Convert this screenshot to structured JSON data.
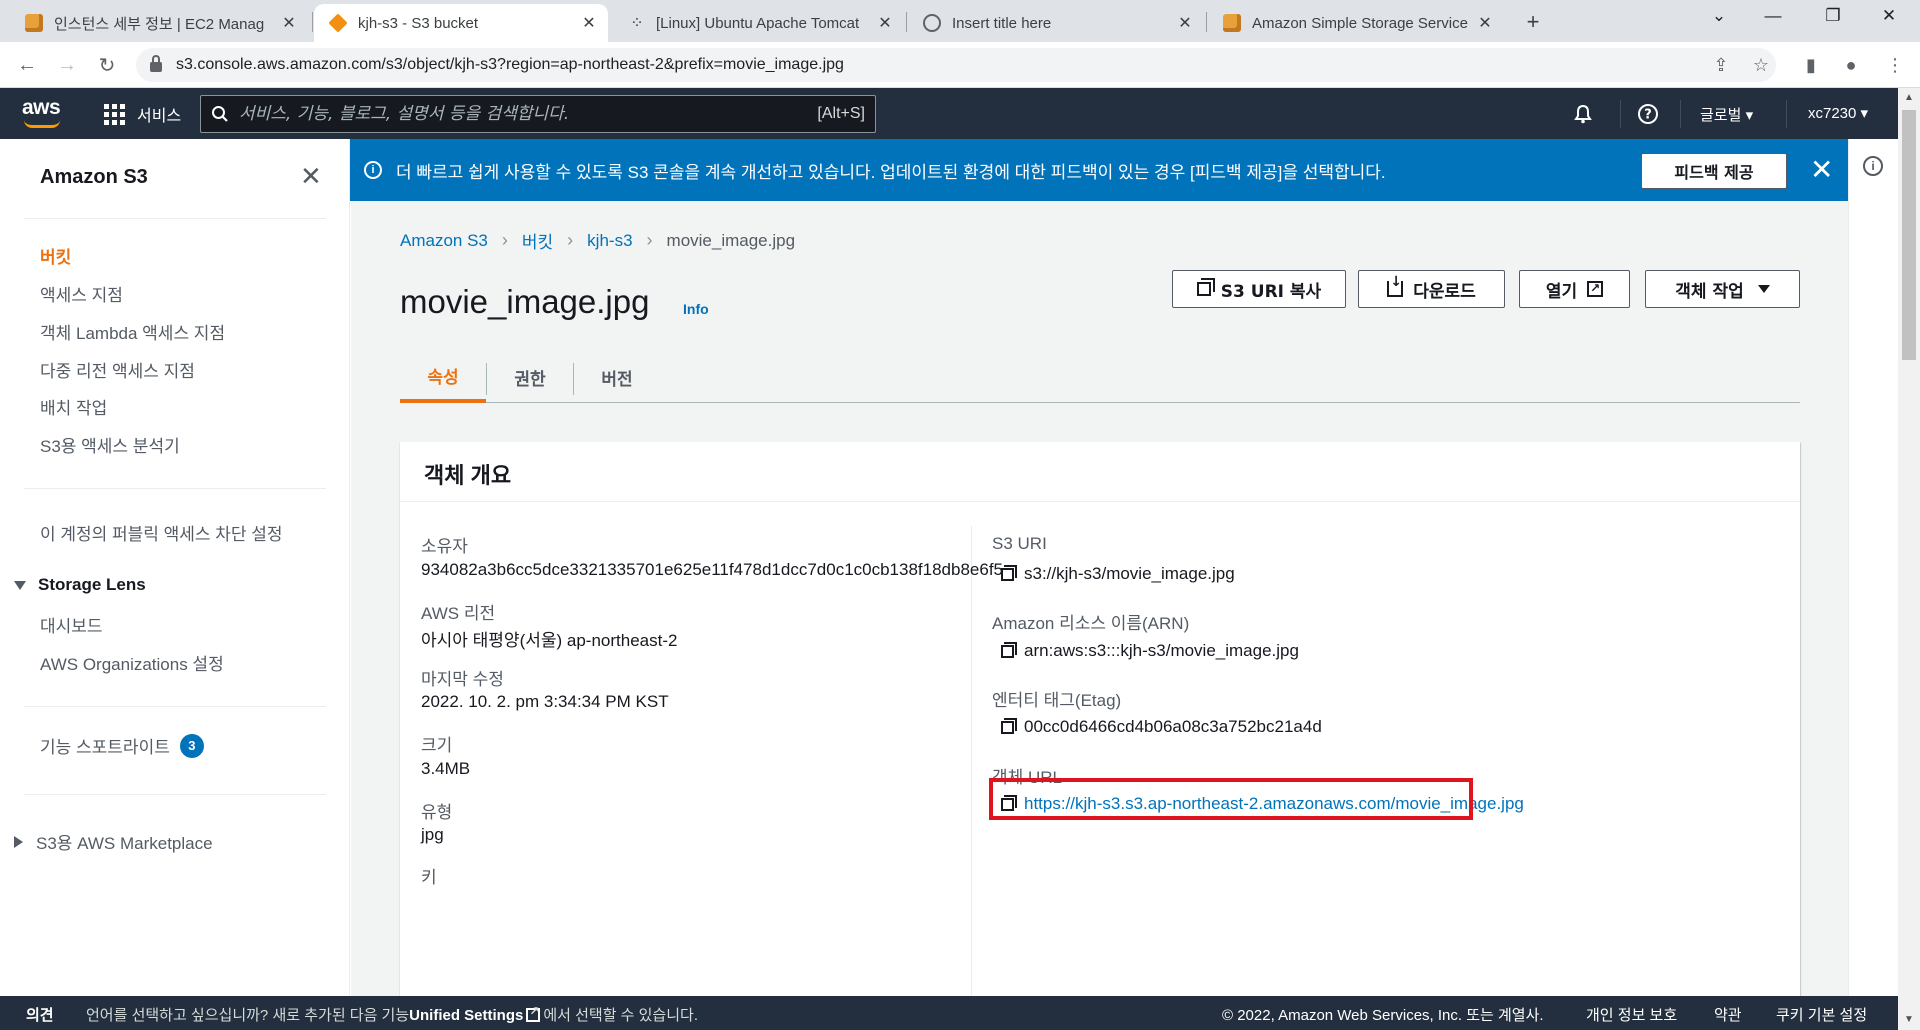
{
  "browser": {
    "tabs": [
      {
        "title": "인스턴스 세부 정보 | EC2 Manag",
        "active": false
      },
      {
        "title": "kjh-s3 - S3 bucket",
        "active": true
      },
      {
        "title": "[Linux] Ubuntu Apache Tomcat",
        "active": false
      },
      {
        "title": "Insert title here",
        "active": false
      },
      {
        "title": "Amazon Simple Storage Service",
        "active": false
      }
    ],
    "url": "s3.console.aws.amazon.com/s3/object/kjh-s3?region=ap-northeast-2&prefix=movie_image.jpg"
  },
  "topnav": {
    "logo": "aws",
    "services_label": "서비스",
    "search_placeholder": "서비스, 기능, 블로그, 설명서 등을 검색합니다.",
    "search_shortcut": "[Alt+S]",
    "region_label": "글로벌",
    "account_label": "xc7230"
  },
  "sidebar": {
    "title": "Amazon S3",
    "items": [
      {
        "label": "버킷",
        "active": true
      },
      {
        "label": "액세스 지점"
      },
      {
        "label": "객체 Lambda 액세스 지점"
      },
      {
        "label": "다중 리전 액세스 지점"
      },
      {
        "label": "배치 작업"
      },
      {
        "label": "S3용 액세스 분석기"
      }
    ],
    "public_block": "이 계정의 퍼블릭 액세스 차단 설정",
    "storage_lens": {
      "label": "Storage Lens",
      "items": [
        "대시보드",
        "AWS Organizations 설정"
      ]
    },
    "feature_spotlight": {
      "label": "기능 스포트라이트",
      "count": "3"
    },
    "marketplace": "S3용 AWS Marketplace"
  },
  "banner": {
    "text": "더 빠르고 쉽게 사용할 수 있도록 S3 콘솔을 계속 개선하고 있습니다. 업데이트된 환경에 대한 피드백이 있는 경우 [피드백 제공]을 선택합니다.",
    "button": "피드백 제공"
  },
  "breadcrumb": [
    "Amazon S3",
    "버킷",
    "kjh-s3",
    "movie_image.jpg"
  ],
  "page": {
    "title": "movie_image.jpg",
    "info": "Info",
    "actions": {
      "copy_uri": "S3 URI 복사",
      "download": "다운로드",
      "open": "열기",
      "object_actions": "객체 작업"
    },
    "tabs": [
      "속성",
      "권한",
      "버전"
    ]
  },
  "overview": {
    "title": "객체 개요",
    "owner_label": "소유자",
    "owner": "934082a3b6cc5dce3321335701e625e11f478d1dcc7d0c1c0cb138f18db8e6f5",
    "region_label": "AWS 리전",
    "region": "아시아 태평양(서울) ap-northeast-2",
    "modified_label": "마지막 수정",
    "modified": "2022. 10. 2. pm 3:34:34 PM KST",
    "size_label": "크기",
    "size": "3.4MB",
    "type_label": "유형",
    "type": "jpg",
    "key_label": "키",
    "s3uri_label": "S3 URI",
    "s3uri": "s3://kjh-s3/movie_image.jpg",
    "arn_label": "Amazon 리소스 이름(ARN)",
    "arn": "arn:aws:s3:::kjh-s3/movie_image.jpg",
    "etag_label": "엔터티 태그(Etag)",
    "etag": "00cc0d6466cd4b06a08c3a752bc21a4d",
    "url_label": "객체 URL",
    "url": "https://kjh-s3.s3.ap-northeast-2.amazonaws.com/movie_image.jpg"
  },
  "footer": {
    "feedback": "의견",
    "lang_prefix": "언어를 선택하고 싶으십니까? 새로 추가된 다음 기능",
    "unified": "Unified Settings",
    "lang_suffix": "에서 선택할 수 있습니다.",
    "copyright": "© 2022, Amazon Web Services, Inc. 또는 계열사.",
    "privacy": "개인 정보 보호",
    "terms": "약관",
    "cookies": "쿠키 기본 설정"
  },
  "colors": {
    "aws_nav": "#232f3e",
    "accent_orange": "#ec7211",
    "link_blue": "#0073bb",
    "banner_blue": "#0073bb",
    "highlight_red": "#e0141e"
  }
}
